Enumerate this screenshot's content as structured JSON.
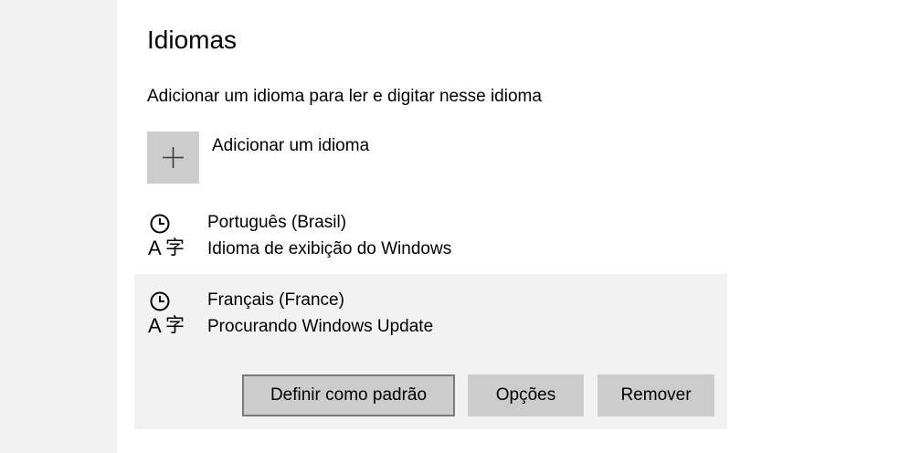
{
  "page": {
    "title": "Idiomas",
    "description": "Adicionar um idioma para ler e digitar nesse idioma"
  },
  "add_language": {
    "label": "Adicionar um idioma",
    "icon": "plus-icon"
  },
  "languages": [
    {
      "name": "Português (Brasil)",
      "status": "Idioma de exibição do Windows",
      "icon": "language-clock-icon"
    },
    {
      "name": "Français (France)",
      "status": "Procurando Windows Update",
      "icon": "language-clock-icon",
      "selected": true,
      "actions": {
        "set_default": "Definir como padrão",
        "options": "Opções",
        "remove": "Remover"
      }
    }
  ],
  "colors": {
    "tile": "#cccccc",
    "selected_bg": "#f2f2f2",
    "focus_border": "#7a7a7a"
  }
}
